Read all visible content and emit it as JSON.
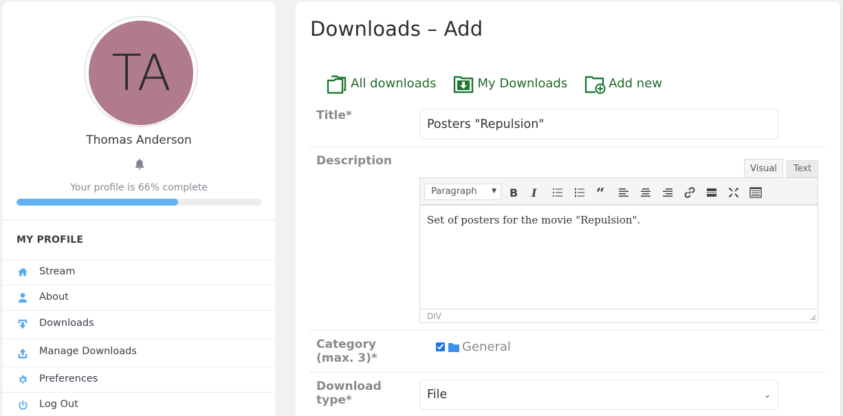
{
  "profile": {
    "initials": "TA",
    "avatar_color": "#b07b8f",
    "name": "Thomas Anderson",
    "completion_text": "Your profile is 66% complete",
    "completion_percent": 66
  },
  "menu": {
    "heading": "MY PROFILE",
    "items": [
      {
        "label": "Stream",
        "icon": "home-icon"
      },
      {
        "label": "About",
        "icon": "user-icon"
      },
      {
        "label": "Downloads",
        "icon": "download-icon"
      },
      {
        "label": "Manage Downloads",
        "icon": "upload-icon"
      },
      {
        "label": "Preferences",
        "icon": "gear-icon"
      },
      {
        "label": "Log Out",
        "icon": "power-icon"
      }
    ]
  },
  "main": {
    "title": "Downloads – Add",
    "nav": [
      {
        "label": "All downloads",
        "icon": "folders-icon"
      },
      {
        "label": "My Downloads",
        "icon": "folder-download-icon"
      },
      {
        "label": "Add new",
        "icon": "folder-add-icon"
      }
    ],
    "accent_color": "#1e6a26"
  },
  "form": {
    "title_label": "Title*",
    "title_value": "Posters \"Repulsion\"",
    "description_label": "Description",
    "editor_tabs": {
      "visual": "Visual",
      "text": "Text"
    },
    "format_select": "Paragraph",
    "toolbar": [
      "bold",
      "italic",
      "bullet-list",
      "numbered-list",
      "blockquote",
      "align-left",
      "align-center",
      "align-right",
      "link",
      "read-more",
      "fullscreen",
      "toolbar-toggle"
    ],
    "description_value": "Set of posters for the movie \"Repulsion\".",
    "editor_path": "DIV",
    "category_label": "Category (max. 3)*",
    "category_label_line1": "Category",
    "category_label_line2": "(max. 3)*",
    "category_option": "General",
    "category_checked": true,
    "download_type_label_line1": "Download",
    "download_type_label_line2": "type*",
    "download_type_value": "File"
  }
}
